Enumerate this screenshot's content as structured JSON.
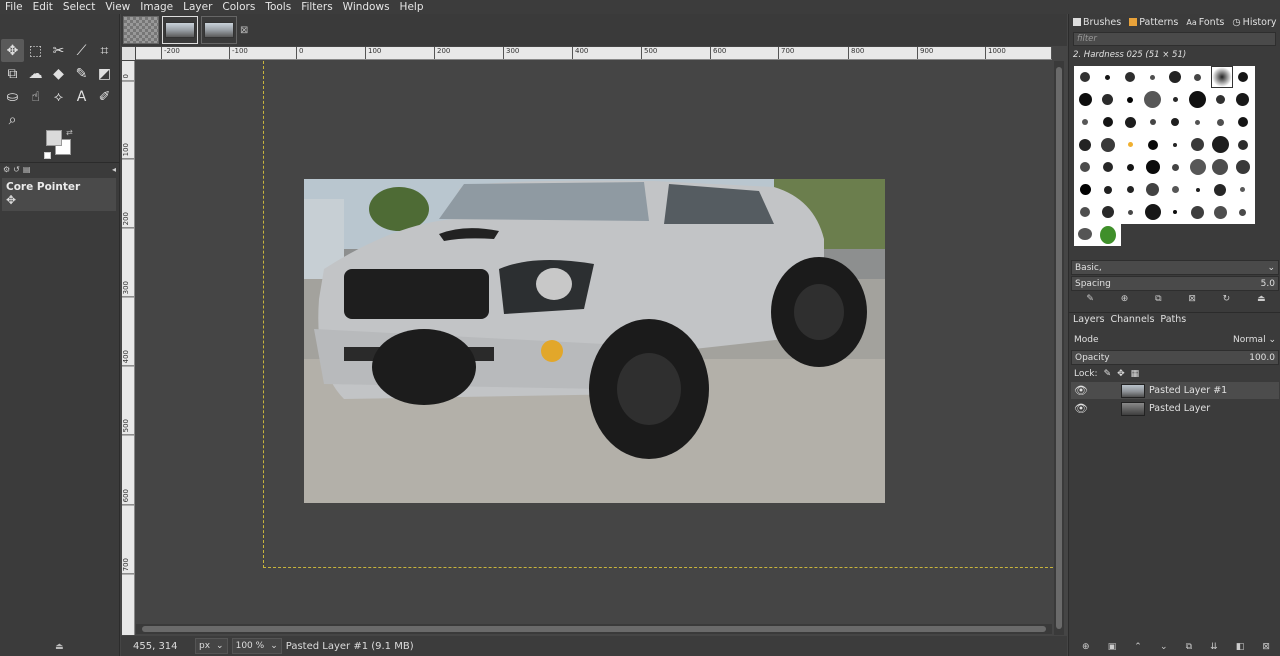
{
  "menu": [
    "File",
    "Edit",
    "Select",
    "View",
    "Image",
    "Layer",
    "Colors",
    "Tools",
    "Filters",
    "Windows",
    "Help"
  ],
  "tool_options": {
    "title": "Core Pointer"
  },
  "ruler": {
    "h_labels": [
      "-200",
      "-100",
      "0",
      "100",
      "200",
      "300",
      "400",
      "500",
      "600",
      "700",
      "800",
      "900",
      "1000",
      "1100"
    ],
    "v_labels": [
      "0",
      "100",
      "200",
      "300",
      "400",
      "500",
      "600",
      "700"
    ]
  },
  "status": {
    "coords": "455, 314",
    "unit": "px",
    "zoom": "100 %",
    "info": "Pasted Layer #1 (9.1 MB)"
  },
  "right_panel": {
    "tabs": [
      "Brushes",
      "Patterns",
      "Fonts",
      "History"
    ],
    "filter_placeholder": "filter",
    "brush_name": "2. Hardness 025 (51 × 51)",
    "preset": "Basic,",
    "spacing_label": "Spacing",
    "spacing_value": "5.0"
  },
  "layers_panel": {
    "tabs": [
      "Layers",
      "Channels",
      "Paths"
    ],
    "mode_label": "Mode",
    "mode_value": "Normal",
    "opacity_label": "Opacity",
    "opacity_value": "100.0",
    "lock_label": "Lock:",
    "layers": [
      {
        "name": "Pasted Layer #1"
      },
      {
        "name": "Pasted Layer"
      }
    ]
  },
  "colors": {
    "selection_border": "#c8b43c",
    "panel_bg": "#3b3b3b",
    "canvas_bg": "#454545"
  }
}
